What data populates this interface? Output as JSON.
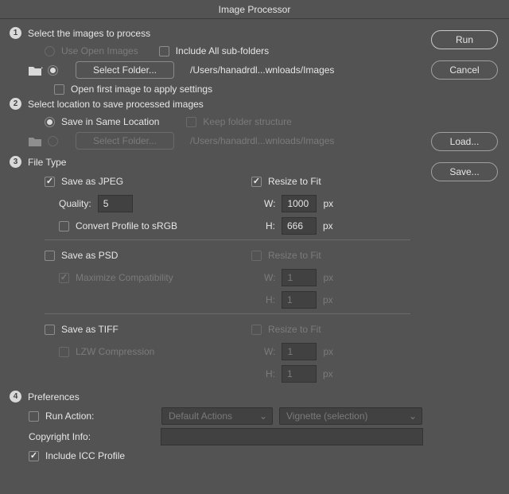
{
  "title": "Image Processor",
  "buttons": {
    "run": "Run",
    "cancel": "Cancel",
    "load": "Load...",
    "save": "Save..."
  },
  "step1": {
    "title": "Select the images to process",
    "useOpenImages": "Use Open Images",
    "includeSubfolders": "Include All sub-folders",
    "selectFolder": "Select Folder...",
    "path": "/Users/hanadrdl...wnloads/Images",
    "openFirst": "Open first image to apply settings"
  },
  "step2": {
    "title": "Select location to save processed images",
    "saveSame": "Save in Same Location",
    "keepStructure": "Keep folder structure",
    "selectFolder": "Select Folder...",
    "path": "/Users/hanadrdl...wnloads/Images"
  },
  "step3": {
    "title": "File Type",
    "jpeg": {
      "save": "Save as JPEG",
      "qualityLabel": "Quality:",
      "quality": "5",
      "convert": "Convert Profile to sRGB",
      "resize": "Resize to Fit",
      "wLabel": "W:",
      "w": "1000",
      "hLabel": "H:",
      "h": "666",
      "px": "px"
    },
    "psd": {
      "save": "Save as PSD",
      "maxComp": "Maximize Compatibility",
      "resize": "Resize to Fit",
      "wLabel": "W:",
      "w": "1",
      "hLabel": "H:",
      "h": "1",
      "px": "px"
    },
    "tiff": {
      "save": "Save as TIFF",
      "lzw": "LZW Compression",
      "resize": "Resize to Fit",
      "wLabel": "W:",
      "w": "1",
      "hLabel": "H:",
      "h": "1",
      "px": "px"
    }
  },
  "step4": {
    "title": "Preferences",
    "runAction": "Run Action:",
    "actionSet": "Default Actions",
    "action": "Vignette (selection)",
    "copyright": "Copyright Info:",
    "icc": "Include ICC Profile"
  }
}
